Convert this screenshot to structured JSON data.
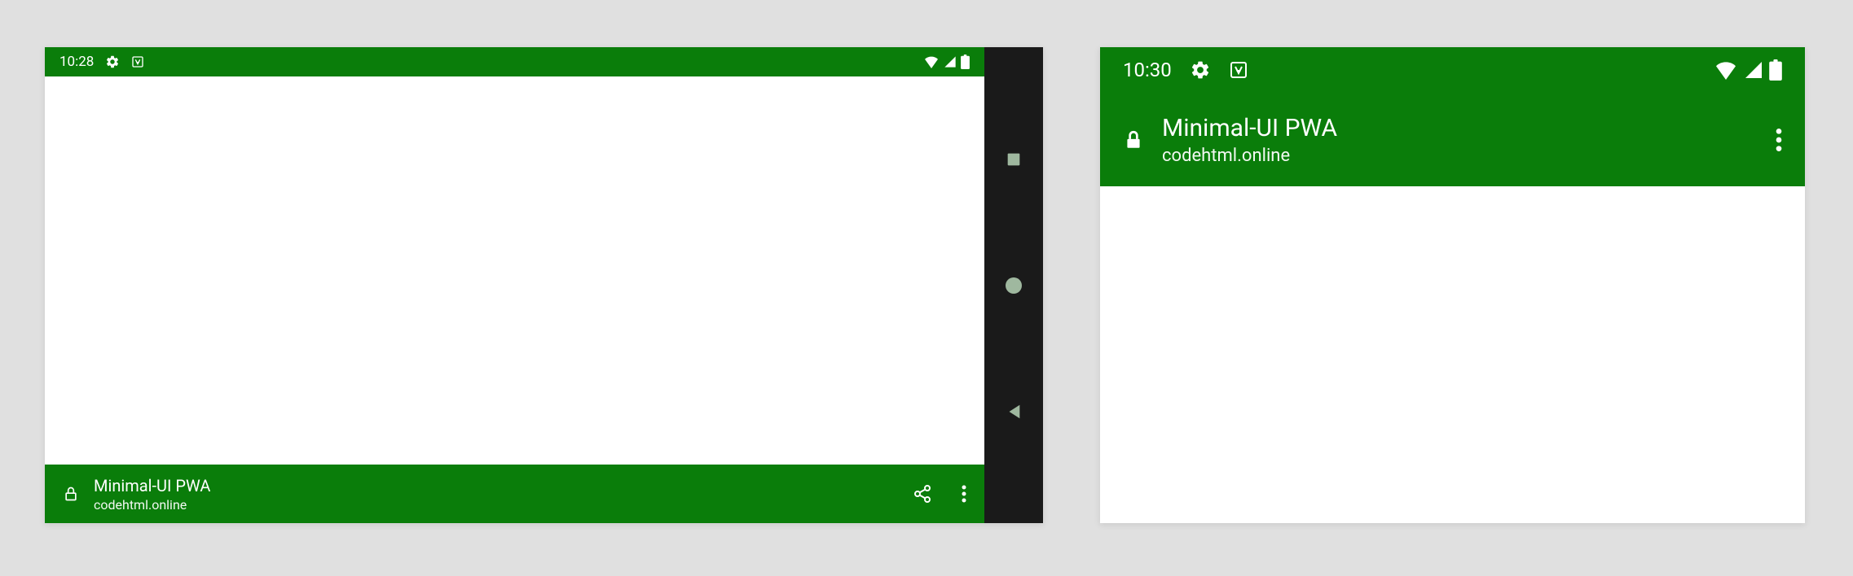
{
  "left_device": {
    "status": {
      "time": "10:28",
      "icons": [
        "gear-icon",
        "text-icon"
      ],
      "right_icons": [
        "wifi-icon",
        "signal-icon",
        "battery-icon"
      ]
    },
    "app_bar": {
      "title": "Minimal-UI PWA",
      "domain": "codehtml.online",
      "actions": [
        "share-icon",
        "more-icon"
      ]
    },
    "nav_buttons": [
      "overview",
      "home",
      "back"
    ]
  },
  "right_device": {
    "status": {
      "time": "10:30",
      "icons": [
        "gear-icon",
        "text-icon"
      ],
      "right_icons": [
        "wifi-icon",
        "signal-icon",
        "battery-icon"
      ]
    },
    "app_bar": {
      "title": "Minimal-UI PWA",
      "domain": "codehtml.online",
      "actions": [
        "more-icon"
      ]
    }
  },
  "colors": {
    "primary": "#0a7d0a",
    "nav_bg": "#1a1a1a",
    "nav_icon": "#9fb89f"
  }
}
